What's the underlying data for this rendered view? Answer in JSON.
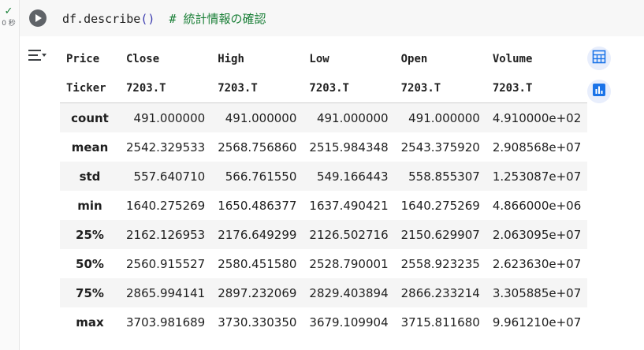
{
  "cell": {
    "exec_check": "✓",
    "exec_time": "0 秒",
    "code_prefix": "df.describe",
    "code_parens": "()",
    "code_comment": "  # 統計情報の確認"
  },
  "table": {
    "header_row1": [
      "Price",
      "Close",
      "High",
      "Low",
      "Open",
      "Volume"
    ],
    "header_row2": [
      "Ticker",
      "7203.T",
      "7203.T",
      "7203.T",
      "7203.T",
      "7203.T"
    ],
    "rows": [
      {
        "label": "count",
        "values": [
          "491.000000",
          "491.000000",
          "491.000000",
          "491.000000",
          "4.910000e+02"
        ]
      },
      {
        "label": "mean",
        "values": [
          "2542.329533",
          "2568.756860",
          "2515.984348",
          "2543.375920",
          "2.908568e+07"
        ]
      },
      {
        "label": "std",
        "values": [
          "557.640710",
          "566.761550",
          "549.166443",
          "558.855307",
          "1.253087e+07"
        ]
      },
      {
        "label": "min",
        "values": [
          "1640.275269",
          "1650.486377",
          "1637.490421",
          "1640.275269",
          "4.866000e+06"
        ]
      },
      {
        "label": "25%",
        "values": [
          "2162.126953",
          "2176.649299",
          "2126.502716",
          "2150.629907",
          "2.063095e+07"
        ]
      },
      {
        "label": "50%",
        "values": [
          "2560.915527",
          "2580.451580",
          "2528.790001",
          "2558.923235",
          "2.623630e+07"
        ]
      },
      {
        "label": "75%",
        "values": [
          "2865.994141",
          "2897.232069",
          "2829.403894",
          "2866.233214",
          "3.305885e+07"
        ]
      },
      {
        "label": "max",
        "values": [
          "3703.981689",
          "3730.330350",
          "3679.109904",
          "3715.811680",
          "9.961210e+07"
        ]
      }
    ]
  },
  "icons": {
    "run": "play-icon",
    "output": "output-actions-icon",
    "table": "table-view-icon",
    "chart": "chart-suggest-icon"
  },
  "colors": {
    "accent": "#1a73e8",
    "comment": "#1a7f37",
    "success": "#188038"
  }
}
